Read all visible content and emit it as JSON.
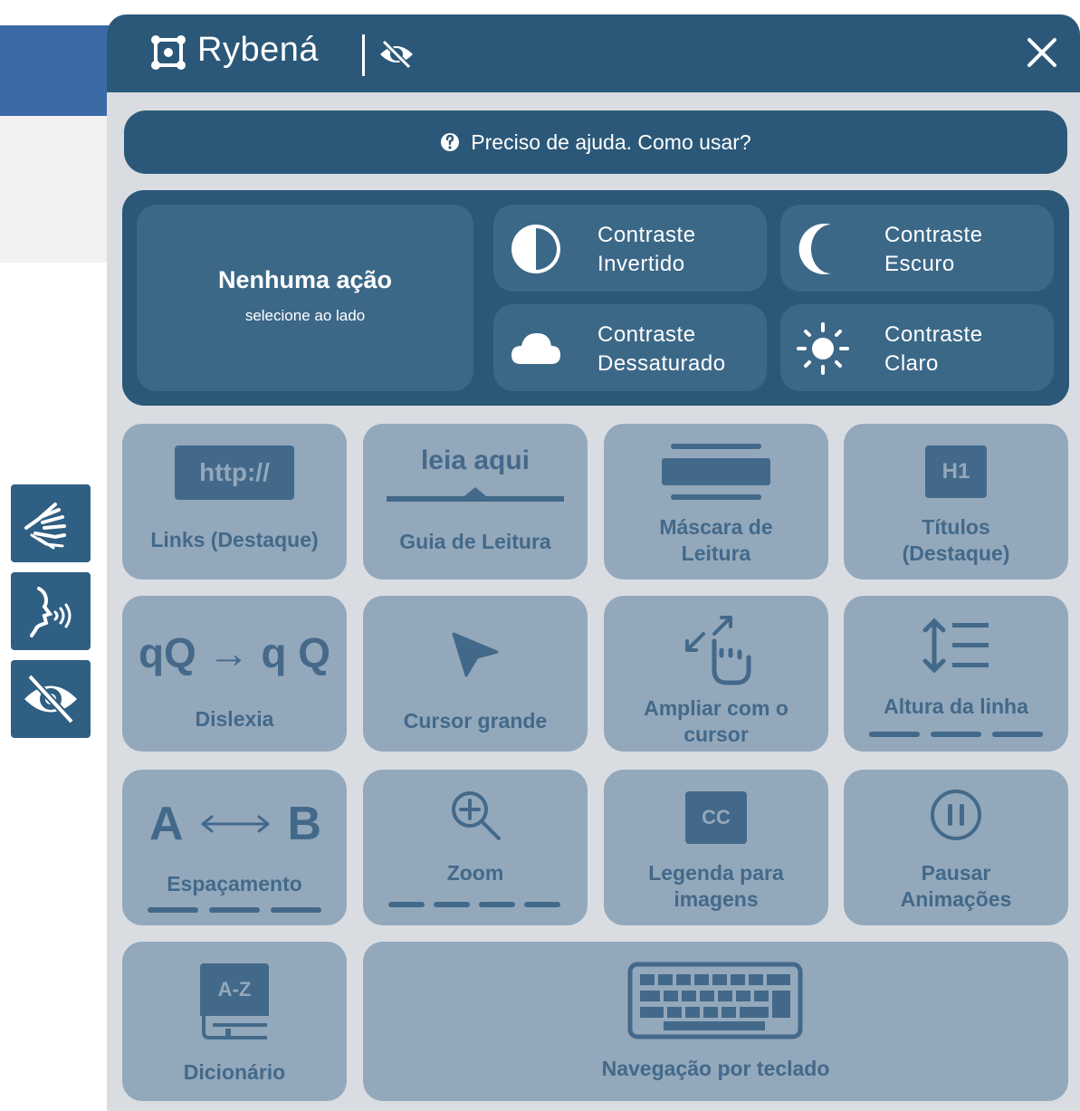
{
  "header": {
    "brand": "Rybená",
    "close_label": "✕"
  },
  "help": {
    "label": "Preciso de ajuda. Como usar?"
  },
  "status": {
    "title": "Nenhuma ação",
    "subtitle": "selecione ao lado"
  },
  "contrast": [
    {
      "line1": "Contraste",
      "line2": "Invertido",
      "icon": "half-circle-icon"
    },
    {
      "line1": "Contraste",
      "line2": "Escuro",
      "icon": "moon-icon"
    },
    {
      "line1": "Contraste",
      "line2": "Dessaturado",
      "icon": "cloud-icon"
    },
    {
      "line1": "Contraste",
      "line2": "Claro",
      "icon": "sun-icon"
    }
  ],
  "tiles": {
    "links": {
      "label": "Links (Destaque)",
      "glyph": "http://"
    },
    "guia": {
      "label": "Guia de Leitura",
      "glyph": "leia aqui"
    },
    "mascara": {
      "line1": "Máscara de",
      "line2": "Leitura"
    },
    "titulos": {
      "line1": "Títulos",
      "line2": "(Destaque)",
      "glyph": "H1"
    },
    "dislexia": {
      "label": "Dislexia",
      "glyph": "qQ → q Q"
    },
    "cursor": {
      "label": "Cursor grande"
    },
    "ampliar": {
      "line1": "Ampliar com o",
      "line2": "cursor"
    },
    "altura": {
      "label": "Altura da linha"
    },
    "espacamento": {
      "label": "Espaçamento",
      "glyph_a": "A",
      "glyph_b": "B"
    },
    "zoom": {
      "label": "Zoom"
    },
    "legenda": {
      "line1": "Legenda para",
      "line2": "imagens",
      "glyph": "CC"
    },
    "pausar": {
      "line1": "Pausar",
      "line2": "Animações"
    },
    "dicionario": {
      "label": "Dicionário",
      "glyph": "A-Z"
    },
    "teclado": {
      "label": "Navegação por teclado"
    }
  },
  "colors": {
    "header": "#2b5878",
    "tile": "#93a8bb",
    "tile_text": "#43698a",
    "panel_bg": "#d9dde2"
  }
}
